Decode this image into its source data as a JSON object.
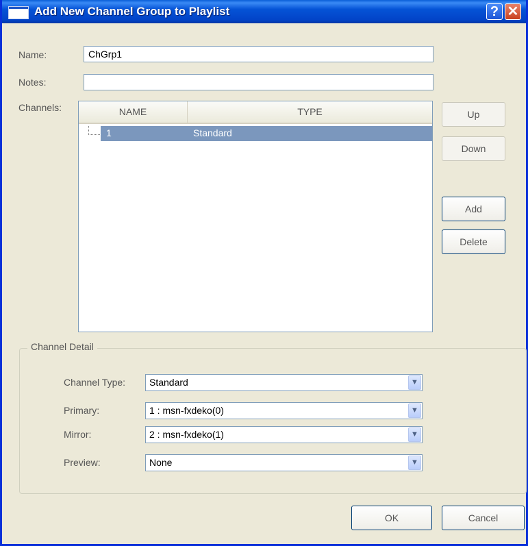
{
  "window": {
    "title": "Add New Channel Group to Playlist",
    "help_glyph": "?",
    "close_glyph": "✕"
  },
  "form": {
    "name_label": "Name:",
    "name_value": "ChGrp1",
    "notes_label": "Notes:",
    "notes_value": "",
    "channels_label": "Channels:"
  },
  "channels": {
    "columns": [
      "NAME",
      "TYPE"
    ],
    "rows": [
      {
        "name": "1",
        "type": "Standard",
        "selected": true
      }
    ]
  },
  "side_buttons": {
    "up": "Up",
    "down": "Down",
    "add": "Add",
    "delete": "Delete"
  },
  "channel_detail": {
    "title": "Channel Detail",
    "channel_type_label": "Channel Type:",
    "channel_type_value": "Standard",
    "primary_label": "Primary:",
    "primary_value": "1 : msn-fxdeko(0)",
    "mirror_label": "Mirror:",
    "mirror_value": "2 : msn-fxdeko(1)",
    "preview_label": "Preview:",
    "preview_value": "None"
  },
  "footer": {
    "ok": "OK",
    "cancel": "Cancel"
  },
  "icons": {
    "dropdown": "chevron-down-icon",
    "window": "window-icon"
  },
  "colors": {
    "titlebar": "#0553d6",
    "selection": "#7b97bd",
    "dialog_bg": "#ece9d8"
  }
}
